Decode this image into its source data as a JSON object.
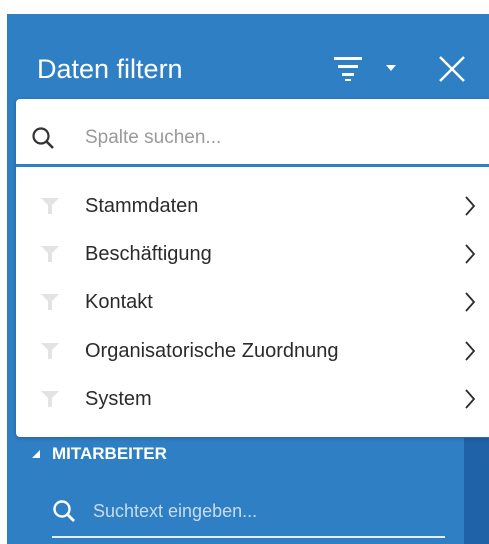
{
  "header": {
    "title": "Daten filtern",
    "icons": [
      "filter-lines-icon",
      "caret-down-icon",
      "close-icon"
    ]
  },
  "dropdown": {
    "search": {
      "placeholder": "Spalte suchen...",
      "value": "",
      "icon": "search-icon"
    },
    "items": [
      {
        "label": "Stammdaten",
        "icon": "funnel-icon",
        "chevron": "chevron-right-icon"
      },
      {
        "label": "Beschäftigung",
        "icon": "funnel-icon",
        "chevron": "chevron-right-icon"
      },
      {
        "label": "Kontakt",
        "icon": "funnel-icon",
        "chevron": "chevron-right-icon"
      },
      {
        "label": "Organisatorische Zuordnung",
        "icon": "funnel-icon",
        "chevron": "chevron-right-icon"
      },
      {
        "label": "System",
        "icon": "funnel-icon",
        "chevron": "chevron-right-icon"
      }
    ]
  },
  "section": {
    "label": "MITARBEITER",
    "search": {
      "placeholder": "Suchtext eingeben...",
      "value": ""
    }
  },
  "colors": {
    "panel": "#2f7fc5",
    "panel_dark": "#1f62a6",
    "accent_line": "#2f7fc5",
    "text": "#2b2b2b",
    "funnel": "#e3e3e3"
  }
}
